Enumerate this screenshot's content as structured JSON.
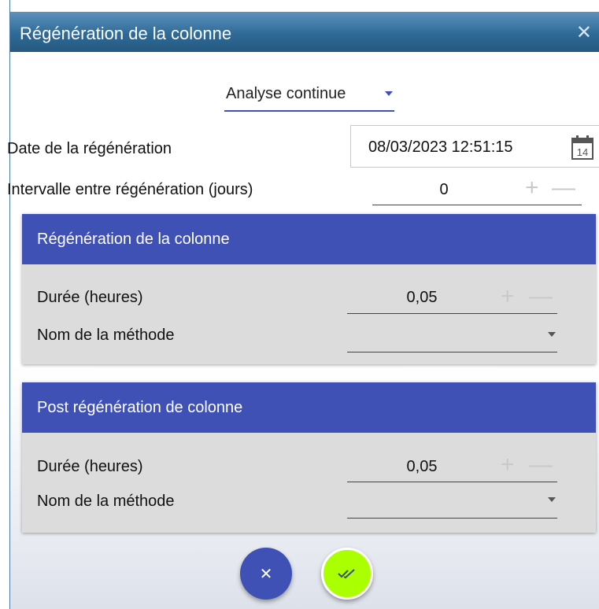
{
  "window": {
    "title": "Régénération de la colonne",
    "close_glyph": "✕"
  },
  "mode": {
    "selected": "Analyse continue"
  },
  "regeneration_date": {
    "label": "Date de la régénération",
    "value": "08/03/2023 12:51:15",
    "calendar_day": "14"
  },
  "interval": {
    "label": "Intervalle entre régénération (jours)",
    "value": "0"
  },
  "card_regen": {
    "title": "Régénération de la colonne",
    "duration_label": "Durée (heures)",
    "duration_value": "0,05",
    "method_label": "Nom de la méthode",
    "method_value": ""
  },
  "card_post": {
    "title": "Post régénération de colonne",
    "duration_label": "Durée (heures)",
    "duration_value": "0,05",
    "method_label": "Nom de la méthode",
    "method_value": ""
  },
  "stepper": {
    "plus": "+",
    "minus": "—"
  },
  "actions": {
    "cancel_glyph": "✕"
  },
  "colors": {
    "accent": "#3f51b5",
    "confirm": "#aaff00",
    "titlebar": "#2f6a97",
    "card_bg": "#dcdcdc"
  }
}
